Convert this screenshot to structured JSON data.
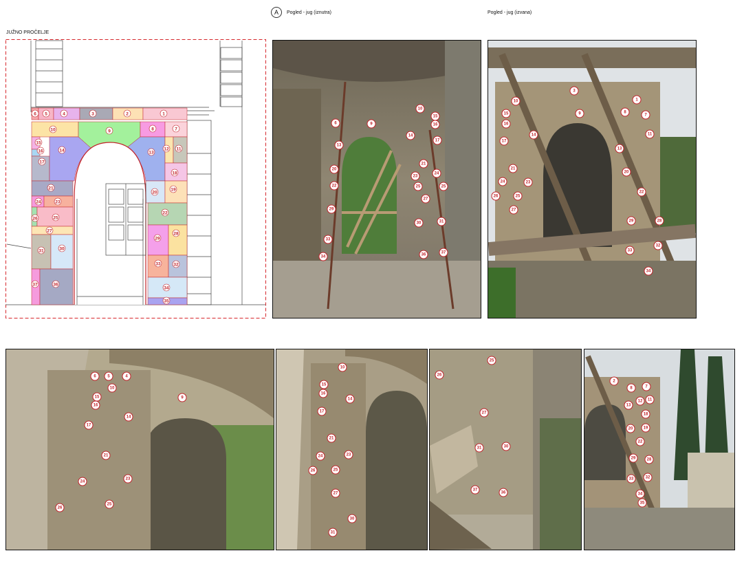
{
  "headers": {
    "marker": "A",
    "view_inside": "Pogled - jug (iznutra)",
    "view_outside": "Pogled - jug (izvana)",
    "facade_title": "JUŽNO PROČELJE"
  },
  "colors": {
    "accent_red": "#c2242b",
    "border_dashed": "#d6262b"
  },
  "zones": [
    {
      "n": "1",
      "c": "#f9c8d3"
    },
    {
      "n": "2",
      "c": "#fde1b5"
    },
    {
      "n": "3",
      "c": "#a9a9b5"
    },
    {
      "n": "4",
      "c": "#e7b3ec"
    },
    {
      "n": "5",
      "c": "#f7b5c6"
    },
    {
      "n": "6",
      "c": "#f6a9ad"
    },
    {
      "n": "7",
      "c": "#fbd3db"
    },
    {
      "n": "8",
      "c": "#f79be2"
    },
    {
      "n": "9",
      "c": "#a3f19c"
    },
    {
      "n": "10",
      "c": "#fce4a6"
    },
    {
      "n": "11",
      "c": "#c7c7ba"
    },
    {
      "n": "12",
      "c": "#fbe6b0"
    },
    {
      "n": "13",
      "c": "#9fb1ee"
    },
    {
      "n": "14",
      "c": "#a9a6f1"
    },
    {
      "n": "15",
      "c": "#f3b3e5"
    },
    {
      "n": "16",
      "c": "#a9d7f3"
    },
    {
      "n": "17",
      "c": "#b6b9cc"
    },
    {
      "n": "18",
      "c": "#f5c6e6"
    },
    {
      "n": "19",
      "c": "#fde1b8"
    },
    {
      "n": "20",
      "c": "#d8e7f7"
    },
    {
      "n": "21",
      "c": "#a8a9c6"
    },
    {
      "n": "22",
      "c": "#b6d6b3"
    },
    {
      "n": "23",
      "c": "#f7b19e"
    },
    {
      "n": "24",
      "c": "#f59bdd"
    },
    {
      "n": "25",
      "c": "#f9bcc8"
    },
    {
      "n": "26",
      "c": "#a4e2b1"
    },
    {
      "n": "27",
      "c": "#fde6b5"
    },
    {
      "n": "28",
      "c": "#fbe2a0"
    },
    {
      "n": "29",
      "c": "#f4a0ea"
    },
    {
      "n": "30",
      "c": "#d6e8f8"
    },
    {
      "n": "31",
      "c": "#c7c1b3"
    },
    {
      "n": "32",
      "c": "#b9c3dc"
    },
    {
      "n": "33",
      "c": "#f7b39c"
    },
    {
      "n": "34",
      "c": "#d5e8f7"
    },
    {
      "n": "35",
      "c": "#a9a3f0"
    },
    {
      "n": "36",
      "c": "#a5a9c4"
    },
    {
      "n": "37",
      "c": "#f59bdd"
    }
  ],
  "photos": [
    {
      "id": "inside",
      "labels": [
        "6",
        "8",
        "9",
        "10",
        "13",
        "14",
        "15",
        "16",
        "17",
        "20",
        "21",
        "22",
        "23",
        "24",
        "25",
        "25",
        "27",
        "29",
        "30",
        "31",
        "33",
        "34",
        "36",
        "37"
      ]
    },
    {
      "id": "outside",
      "labels": [
        "1",
        "3",
        "7",
        "8",
        "9",
        "10",
        "11",
        "13",
        "14",
        "15",
        "16",
        "17",
        "20",
        "21",
        "22",
        "23",
        "24",
        "25",
        "26",
        "27",
        "28",
        "29",
        "32",
        "33",
        "34"
      ]
    },
    {
      "id": "bl1",
      "labels": [
        "4",
        "5",
        "6",
        "9",
        "10",
        "14",
        "15",
        "16",
        "17",
        "21",
        "23",
        "24",
        "25",
        "26"
      ]
    },
    {
      "id": "bl2",
      "labels": [
        "10",
        "14",
        "15",
        "16",
        "17",
        "21",
        "23",
        "24",
        "25",
        "26",
        "27",
        "30",
        "31"
      ]
    },
    {
      "id": "bl3",
      "labels": [
        "25",
        "26",
        "27",
        "30",
        "31",
        "36",
        "37"
      ]
    },
    {
      "id": "bl4",
      "labels": [
        "2",
        "7",
        "8",
        "11",
        "12",
        "13",
        "18",
        "19",
        "20",
        "22",
        "28",
        "29",
        "32",
        "33",
        "34",
        "35"
      ]
    }
  ]
}
